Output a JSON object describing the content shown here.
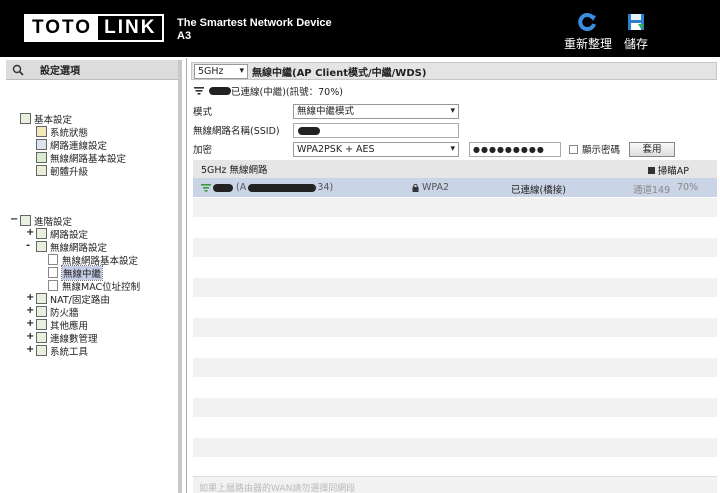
{
  "header": {
    "logo_left": "TOTO",
    "logo_right": "LINK",
    "tagline_line1": "The Smartest Network Device",
    "tagline_line2": "A3",
    "restart_label": "重新整理",
    "save_label": "儲存"
  },
  "left": {
    "title": "設定選項",
    "basic": {
      "label": "基本設定",
      "items": [
        {
          "label": "系統狀態",
          "icon": "chart-icon"
        },
        {
          "label": "網路連線設定",
          "icon": "settings-icon"
        },
        {
          "label": "無線網路基本設定",
          "icon": "wireless-icon"
        },
        {
          "label": "韌體升級",
          "icon": "upgrade-icon"
        }
      ]
    },
    "advanced": {
      "label": "進階設定",
      "items": [
        {
          "label": "網路設定",
          "pm": "+"
        },
        {
          "label": "無線網路設定",
          "pm": "-"
        },
        {
          "label": "NAT/固定路由",
          "pm": "+"
        },
        {
          "label": "防火牆",
          "pm": "+"
        },
        {
          "label": "其他應用",
          "pm": "+"
        },
        {
          "label": "連線數管理",
          "pm": "+"
        },
        {
          "label": "系統工具",
          "pm": "+"
        }
      ],
      "wireless_sub": [
        {
          "label": "無線網路基本設定"
        },
        {
          "label": "無線中繼",
          "selected": true
        },
        {
          "label": "無線MAC位址控制"
        }
      ]
    }
  },
  "main": {
    "band": "5GHz",
    "mode_title": "無線中繼(AP Client模式/中繼/WDS)",
    "connection_status": "已連線(中繼)(訊號：70%)",
    "fields": {
      "mode_label": "模式",
      "mode_value": "無線中繼模式",
      "ssid_label": "無線網路名稱(SSID)",
      "enc_label": "加密",
      "enc_value": "WPA2PSK + AES",
      "password_value": "●●●●●●●●●",
      "show_password_label": "顯示密碼",
      "apply_label": "套用"
    },
    "list": {
      "title": "5GHz 無線網路",
      "scan_label": "掃瞄AP",
      "row": {
        "ssid_prefix": "(A",
        "ssid_suffix": "-34)",
        "security": "WPA2",
        "status": "已連線(橋接)",
        "channel": "通道149",
        "signal": "70%"
      }
    },
    "bottom_note": "如果上層路由器的WAN請勿選擇同網段"
  }
}
